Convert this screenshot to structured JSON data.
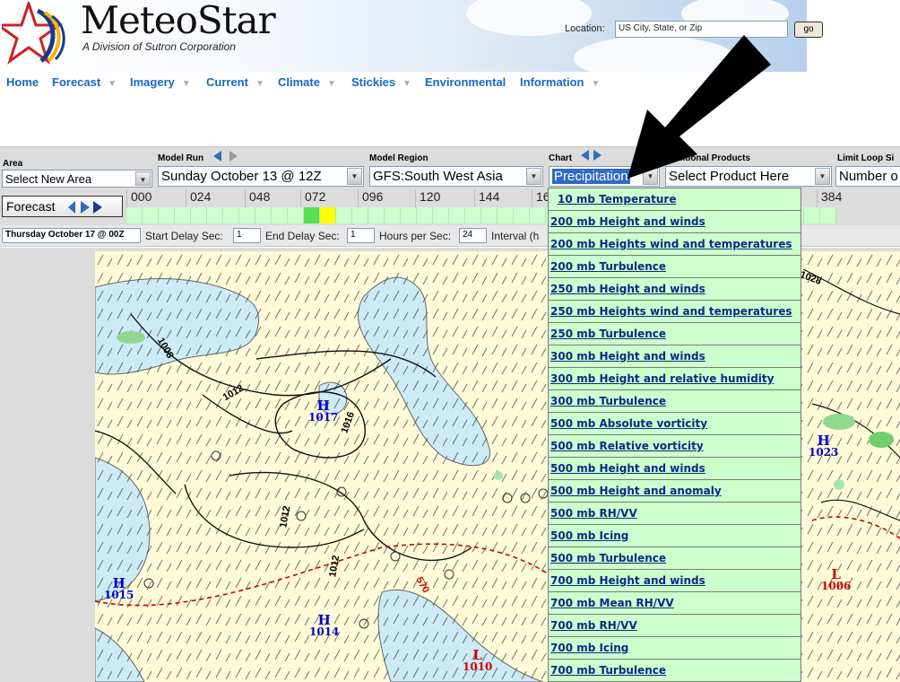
{
  "header": {
    "brand": "MeteoStar",
    "subtitle": "A Division of Sutron Corporation",
    "location_label": "Location:",
    "location_value": "US City, State, or Zip",
    "go_label": "go"
  },
  "nav": [
    {
      "label": "Home",
      "has_menu": false
    },
    {
      "label": "Forecast",
      "has_menu": true
    },
    {
      "label": "Imagery",
      "has_menu": true
    },
    {
      "label": "Current",
      "has_menu": true
    },
    {
      "label": "Climate",
      "has_menu": true
    },
    {
      "label": "Stickies",
      "has_menu": true
    },
    {
      "label": "Environmental",
      "has_menu": false
    },
    {
      "label": "Information",
      "has_menu": true
    }
  ],
  "controls": {
    "area_label": "Area",
    "area_value": "Select New Area",
    "model_run_label": "Model Run",
    "model_run_value": "Sunday October 13 @ 12Z",
    "model_region_label": "Model Region",
    "model_region_value": "GFS:South West Asia",
    "chart_label": "Chart",
    "chart_value": "Precipitation",
    "additional_label": "Additional Products",
    "additional_value": "Select Product Here",
    "limit_label": "Limit Loop Si",
    "limit_value": "Number o"
  },
  "timeline": {
    "forecast_label": "Forecast",
    "hours": [
      "000",
      "024",
      "048",
      "072",
      "096",
      "120",
      "144",
      "16",
      "384"
    ],
    "highlight_cells": {
      "green": 11,
      "yellow": 12
    },
    "cell_count": 44
  },
  "settings": {
    "date_value": "Thursday October 17 @ 00Z",
    "start_delay_label": "Start Delay Sec:",
    "start_delay_value": "1",
    "end_delay_label": "End Delay Sec:",
    "end_delay_value": "1",
    "hours_per_sec_label": "Hours per Sec:",
    "hours_per_sec_value": "24",
    "interval_label": "Interval (h"
  },
  "chart_menu": [
    "10 mb Temperature",
    "200 mb Height and winds",
    "200 mb Heights wind and temperatures",
    "200 mb Turbulence",
    "250 mb Height and winds",
    "250 mb Heights wind and temperatures",
    "250 mb Turbulence",
    "300 mb Height and winds",
    "300 mb Height and relative humidity",
    "300 mb Turbulence",
    "500 mb Absolute vorticity",
    "500 mb Relative vorticity",
    "500 mb Height and winds",
    "500 mb Height and anomaly",
    "500 mb RH/VV",
    "500 mb Icing",
    "500 mb Turbulence",
    "700 mb Height and winds",
    "700 mb Mean RH/VV",
    "700 mb RH/VV",
    "700 mb Icing",
    "700 mb Turbulence"
  ],
  "map": {
    "isobars": [
      "1008",
      "1012",
      "1012",
      "1016",
      "1012",
      "1012",
      "1028"
    ],
    "thickness_label": "570",
    "pressure_centers": [
      {
        "type": "H",
        "value": "1017"
      },
      {
        "type": "H",
        "value": "1015"
      },
      {
        "type": "H",
        "value": "1014"
      },
      {
        "type": "L",
        "value": "1010"
      },
      {
        "type": "H",
        "value": "1023"
      },
      {
        "type": "L",
        "value": "1006"
      }
    ]
  },
  "colors": {
    "nav_link": "#1569c7",
    "menu_bg": "#ccffcc",
    "menu_text": "#0c2a86",
    "water": "#cdeaf7",
    "land": "#fffbd8",
    "high": "#0000cc",
    "low": "#cc0000",
    "precip": "#8fd98f"
  }
}
